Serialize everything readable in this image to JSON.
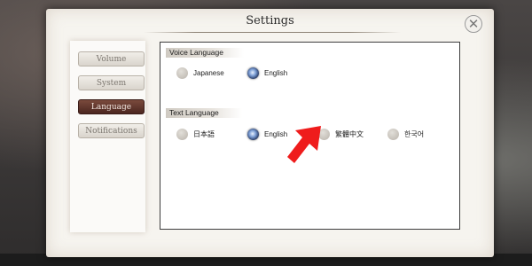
{
  "dialog": {
    "title": "Settings",
    "close_glyph": "✕"
  },
  "nav": {
    "items": [
      {
        "label": "Volume",
        "active": false
      },
      {
        "label": "System",
        "active": false
      },
      {
        "label": "Language",
        "active": true
      },
      {
        "label": "Notifications",
        "active": false
      }
    ]
  },
  "voice_language": {
    "title": "Voice Language",
    "options": [
      {
        "label": "Japanese",
        "selected": false
      },
      {
        "label": "English",
        "selected": true
      }
    ]
  },
  "text_language": {
    "title": "Text Language",
    "options": [
      {
        "label": "日本語",
        "selected": false
      },
      {
        "label": "English",
        "selected": true
      },
      {
        "label": "繁體中文",
        "selected": false
      },
      {
        "label": "한국어",
        "selected": false
      }
    ]
  },
  "annotation": {
    "arrow_icon": "red-arrow-icon",
    "arrow_color": "#ef1c1c"
  }
}
